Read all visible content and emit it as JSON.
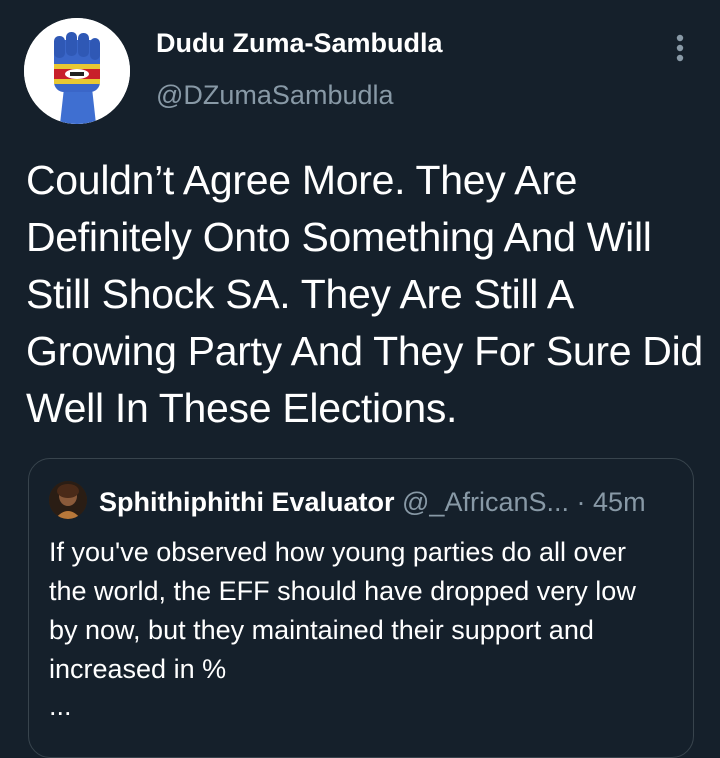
{
  "tweet": {
    "author": {
      "display_name": "Dudu Zuma-Sambudla",
      "handle": "@DZumaSambudla",
      "avatar_icon": "raised-fist-flag-avatar"
    },
    "more_icon": "vertical-ellipsis-icon",
    "text": "Couldn’t Agree More. They Are Definitely Onto Something And Will Still Shock SA. They Are Still A Growing Party And They For Sure Did Well In These Elections.",
    "quoted": {
      "display_name": "Sphithiphithi Evaluator",
      "handle": "@_AfricanS...",
      "separator": "·",
      "time": "45m",
      "avatar_icon": "portrait-avatar",
      "text": "If you've observed how young parties do all over the world, the EFF should have dropped very low by now, but they maintained their support and increased in %",
      "ellipsis": "..."
    }
  },
  "colors": {
    "background": "#15202b",
    "primary_text": "#ffffff",
    "secondary_text": "#8899a6",
    "border": "#38444d"
  }
}
